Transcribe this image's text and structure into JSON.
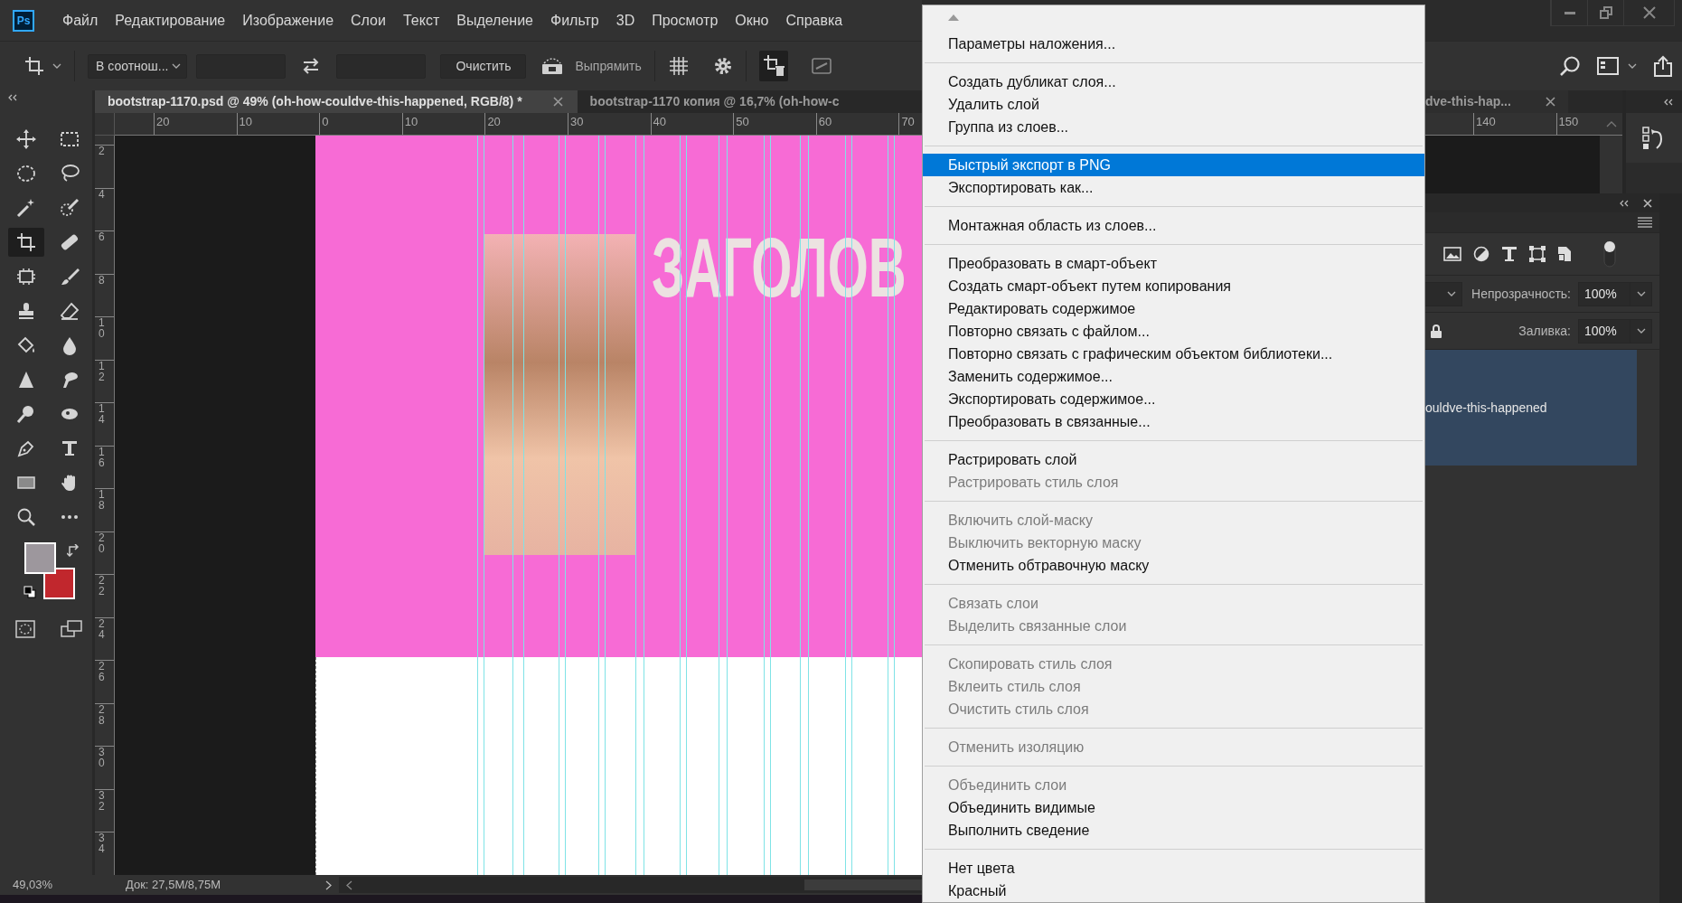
{
  "app_logo": "Ps",
  "menu_bar": [
    "Файл",
    "Редактирование",
    "Изображение",
    "Слои",
    "Текст",
    "Выделение",
    "Фильтр",
    "3D",
    "Просмотр",
    "Окно",
    "Справка"
  ],
  "options_bar": {
    "ratio_select": "В соотнош...",
    "clear_button": "Очистить",
    "straighten_label": "Выпрямить"
  },
  "document_tabs": [
    {
      "title": "bootstrap-1170.psd @ 49% (oh-how-couldve-this-happened, RGB/8) *",
      "selected": true
    },
    {
      "title": "bootstrap-1170 копия @ 16,7% (oh-how-c",
      "selected": false
    }
  ],
  "tools": [
    {
      "selected": false
    },
    {
      "selected": false
    },
    {
      "selected": false
    },
    {
      "selected": false
    },
    {
      "selected": false
    },
    {
      "selected": false
    },
    {
      "selected": true
    },
    {
      "selected": false
    },
    {
      "selected": false
    },
    {
      "selected": false
    },
    {
      "selected": false
    },
    {
      "selected": false
    },
    {
      "selected": false
    },
    {
      "selected": false
    },
    {
      "selected": false
    },
    {
      "selected": false
    },
    {
      "selected": false
    },
    {
      "selected": false
    },
    {
      "selected": false
    },
    {
      "selected": false
    },
    {
      "selected": false
    },
    {
      "selected": false
    },
    {
      "selected": false
    },
    {
      "selected": false
    }
  ],
  "color_swatches": [
    {
      "color": "#9d979d"
    },
    {
      "color": "#c1272d"
    }
  ],
  "rulers": {
    "horizontal": [
      "20",
      "10",
      "0",
      "10",
      "20",
      "30",
      "40",
      "50",
      "60",
      "70"
    ],
    "vertical": [
      "2",
      "4",
      "6",
      "8",
      "10",
      "12",
      "14",
      "16",
      "18",
      "20",
      "22",
      "24",
      "26",
      "28",
      "30",
      "32",
      "34"
    ]
  },
  "artboard": {
    "heading": "ЗАГОЛОВ"
  },
  "status_bar": {
    "zoom": "49,03%",
    "document": "Док: 27,5M/8,75M"
  },
  "context_menu": {
    "groups": [
      [
        {
          "label": "Параметры наложения...",
          "disabled": false,
          "selected": false
        }
      ],
      [
        {
          "label": "Создать дубликат слоя...",
          "disabled": false,
          "selected": false
        },
        {
          "label": "Удалить слой",
          "disabled": false,
          "selected": false
        },
        {
          "label": "Группа из слоев...",
          "disabled": false,
          "selected": false
        }
      ],
      [
        {
          "label": "Быстрый экспорт в PNG",
          "disabled": false,
          "selected": true
        },
        {
          "label": "Экспортировать как...",
          "disabled": false,
          "selected": false
        }
      ],
      [
        {
          "label": "Монтажная область из слоев...",
          "disabled": false,
          "selected": false
        }
      ],
      [
        {
          "label": "Преобразовать в смарт-объект",
          "disabled": false,
          "selected": false
        },
        {
          "label": "Создать смарт-объект путем копирования",
          "disabled": false,
          "selected": false
        },
        {
          "label": "Редактировать содержимое",
          "disabled": false,
          "selected": false
        },
        {
          "label": "Повторно связать с файлом...",
          "disabled": false,
          "selected": false
        },
        {
          "label": "Повторно связать с графическим объектом библиотеки...",
          "disabled": false,
          "selected": false
        },
        {
          "label": "Заменить содержимое...",
          "disabled": false,
          "selected": false
        },
        {
          "label": "Экспортировать содержимое...",
          "disabled": false,
          "selected": false
        },
        {
          "label": "Преобразовать в связанные...",
          "disabled": false,
          "selected": false
        }
      ],
      [
        {
          "label": "Растрировать слой",
          "disabled": false,
          "selected": false
        },
        {
          "label": "Растрировать стиль слоя",
          "disabled": true,
          "selected": false
        }
      ],
      [
        {
          "label": "Включить слой-маску",
          "disabled": true,
          "selected": false
        },
        {
          "label": "Выключить векторную маску",
          "disabled": true,
          "selected": false
        },
        {
          "label": "Отменить обтравочную маску",
          "disabled": false,
          "selected": false
        }
      ],
      [
        {
          "label": "Связать слои",
          "disabled": true,
          "selected": false
        },
        {
          "label": "Выделить связанные слои",
          "disabled": true,
          "selected": false
        }
      ],
      [
        {
          "label": "Скопировать стиль слоя",
          "disabled": true,
          "selected": false
        },
        {
          "label": "Вклеить стиль слоя",
          "disabled": true,
          "selected": false
        },
        {
          "label": "Очистить стиль слоя",
          "disabled": true,
          "selected": false
        }
      ],
      [
        {
          "label": "Отменить изоляцию",
          "disabled": true,
          "selected": false
        }
      ],
      [
        {
          "label": "Объединить слои",
          "disabled": true,
          "selected": false
        },
        {
          "label": "Объединить видимые",
          "disabled": false,
          "selected": false
        },
        {
          "label": "Выполнить сведение",
          "disabled": false,
          "selected": false
        }
      ],
      [
        {
          "label": "Нет цвета",
          "disabled": false,
          "selected": false
        },
        {
          "label": "Красный",
          "disabled": false,
          "selected": false
        }
      ]
    ]
  },
  "tab_continuation": {
    "title": "dve-this-hap..."
  },
  "right_ruler": [
    "140",
    "150"
  ],
  "layers_panel": {
    "filter_on": true,
    "opacity_label": "Непрозрачность:",
    "opacity": "100%",
    "fill_label": "Заливка:",
    "fill": "100%",
    "layers": [
      {
        "name": "ouldve-this-happened",
        "selected": true
      }
    ]
  }
}
